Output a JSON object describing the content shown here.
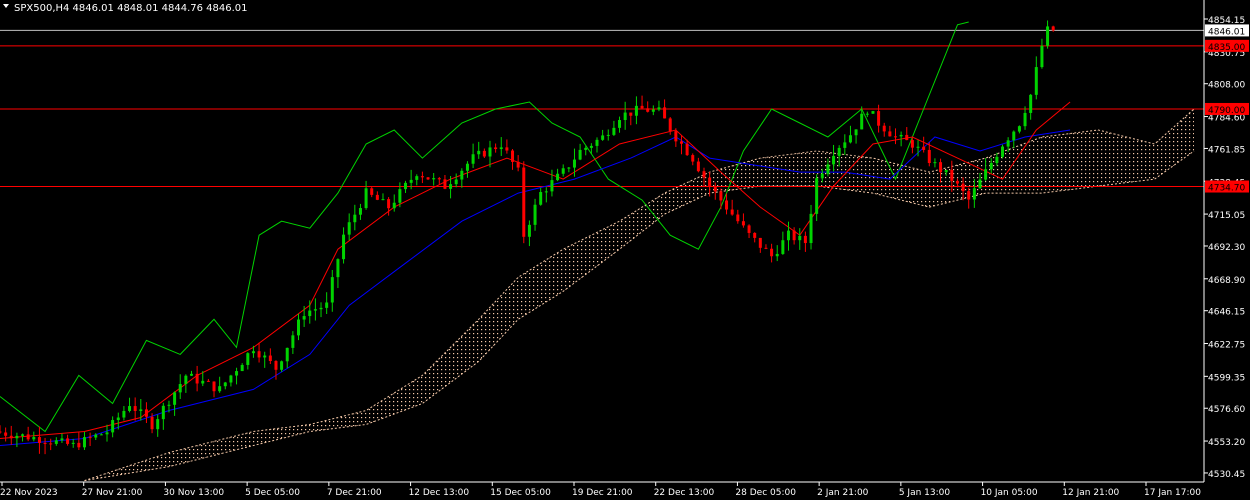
{
  "header": {
    "symbol_line": "SPX500,H4  4846.01 4848.01 4844.76 4846.01",
    "dropdown_icon": "triangle-down-icon"
  },
  "colors": {
    "background": "#000000",
    "grid_text": "#ffffff",
    "bull_candle": "#00d400",
    "bear_candle": "#ff0000",
    "tenkan": "#ff0000",
    "kijun": "#0000ff",
    "chikou": "#00d400",
    "kumo": "#f4c8a8",
    "level_line": "#ff0000",
    "price_badge": "#ff0000",
    "current_price_bg": "#ffffff"
  },
  "chart_data": {
    "type": "candlestick",
    "instrument": "SPX500",
    "timeframe": "H4",
    "ohlc_last": {
      "open": 4846.01,
      "high": 4848.01,
      "low": 4844.76,
      "close": 4846.01
    },
    "ylim": [
      4524,
      4862
    ],
    "y_ticks": [
      "4854.15",
      "4830.75",
      "4808.00",
      "4784.60",
      "4761.85",
      "4738.45",
      "4715.05",
      "4692.30",
      "4668.90",
      "4646.15",
      "4622.75",
      "4599.35",
      "4576.60",
      "4553.20",
      "4530.45"
    ],
    "x_ticks": [
      "22 Nov 2023",
      "27 Nov 21:00",
      "30 Nov 13:00",
      "5 Dec 05:00",
      "7 Dec 21:00",
      "12 Dec 13:00",
      "15 Dec 05:00",
      "19 Dec 21:00",
      "22 Dec 13:00",
      "28 Dec 05:00",
      "2 Jan 21:00",
      "5 Jan 13:00",
      "10 Jan 05:00",
      "12 Jan 21:00",
      "17 Jan 17:00"
    ],
    "current_price": "4846.01",
    "levels": [
      {
        "label": "4835.00",
        "value": 4835.0
      },
      {
        "label": "4790.00",
        "value": 4790.0
      },
      {
        "label": "4734.70",
        "value": 4734.7
      }
    ],
    "price_path": [
      [
        0,
        4560
      ],
      [
        8,
        4555
      ],
      [
        14,
        4550
      ],
      [
        20,
        4560
      ],
      [
        24,
        4580
      ],
      [
        28,
        4565
      ],
      [
        34,
        4600
      ],
      [
        40,
        4590
      ],
      [
        46,
        4620
      ],
      [
        50,
        4605
      ],
      [
        55,
        4645
      ],
      [
        59,
        4650
      ],
      [
        62,
        4700
      ],
      [
        66,
        4730
      ],
      [
        70,
        4720
      ],
      [
        75,
        4745
      ],
      [
        80,
        4735
      ],
      [
        85,
        4755
      ],
      [
        90,
        4765
      ],
      [
        93,
        4745
      ],
      [
        94,
        4700
      ],
      [
        97,
        4730
      ],
      [
        101,
        4745
      ],
      [
        104,
        4760
      ],
      [
        108,
        4770
      ],
      [
        111,
        4785
      ],
      [
        115,
        4790
      ],
      [
        118,
        4788
      ],
      [
        121,
        4770
      ],
      [
        124,
        4755
      ],
      [
        127,
        4735
      ],
      [
        130,
        4720
      ],
      [
        134,
        4700
      ],
      [
        138,
        4685
      ],
      [
        141,
        4700
      ],
      [
        144,
        4695
      ],
      [
        146,
        4740
      ],
      [
        149,
        4760
      ],
      [
        152,
        4772
      ],
      [
        155,
        4790
      ],
      [
        157,
        4780
      ],
      [
        160,
        4770
      ],
      [
        163,
        4765
      ],
      [
        167,
        4750
      ],
      [
        170,
        4740
      ],
      [
        173,
        4725
      ],
      [
        176,
        4745
      ],
      [
        179,
        4765
      ],
      [
        182,
        4780
      ],
      [
        184,
        4800
      ],
      [
        186,
        4835
      ],
      [
        187,
        4846
      ]
    ],
    "tenkan_path": [
      [
        0,
        4555
      ],
      [
        15,
        4560
      ],
      [
        25,
        4570
      ],
      [
        35,
        4600
      ],
      [
        45,
        4620
      ],
      [
        55,
        4650
      ],
      [
        60,
        4690
      ],
      [
        70,
        4720
      ],
      [
        80,
        4740
      ],
      [
        90,
        4755
      ],
      [
        100,
        4740
      ],
      [
        110,
        4765
      ],
      [
        120,
        4775
      ],
      [
        128,
        4745
      ],
      [
        135,
        4720
      ],
      [
        142,
        4700
      ],
      [
        148,
        4735
      ],
      [
        155,
        4765
      ],
      [
        162,
        4770
      ],
      [
        170,
        4755
      ],
      [
        178,
        4740
      ],
      [
        184,
        4775
      ],
      [
        190,
        4795
      ]
    ],
    "kijun_path": [
      [
        0,
        4550
      ],
      [
        15,
        4555
      ],
      [
        30,
        4575
      ],
      [
        45,
        4590
      ],
      [
        55,
        4615
      ],
      [
        62,
        4650
      ],
      [
        72,
        4680
      ],
      [
        82,
        4710
      ],
      [
        92,
        4730
      ],
      [
        102,
        4740
      ],
      [
        112,
        4755
      ],
      [
        120,
        4770
      ],
      [
        126,
        4755
      ],
      [
        134,
        4750
      ],
      [
        142,
        4745
      ],
      [
        150,
        4745
      ],
      [
        158,
        4740
      ],
      [
        166,
        4770
      ],
      [
        174,
        4760
      ],
      [
        182,
        4770
      ],
      [
        190,
        4775
      ]
    ],
    "chikou_path": [
      [
        0,
        4585
      ],
      [
        8,
        4560
      ],
      [
        14,
        4600
      ],
      [
        20,
        4580
      ],
      [
        26,
        4625
      ],
      [
        32,
        4615
      ],
      [
        38,
        4640
      ],
      [
        42,
        4620
      ],
      [
        46,
        4700
      ],
      [
        50,
        4710
      ],
      [
        55,
        4705
      ],
      [
        60,
        4730
      ],
      [
        65,
        4765
      ],
      [
        70,
        4775
      ],
      [
        75,
        4755
      ],
      [
        82,
        4780
      ],
      [
        88,
        4790
      ],
      [
        94,
        4795
      ],
      [
        98,
        4780
      ],
      [
        103,
        4770
      ],
      [
        108,
        4740
      ],
      [
        114,
        4725
      ],
      [
        119,
        4700
      ],
      [
        124,
        4690
      ],
      [
        128,
        4720
      ],
      [
        132,
        4760
      ],
      [
        137,
        4790
      ],
      [
        142,
        4780
      ],
      [
        147,
        4770
      ],
      [
        153,
        4790
      ],
      [
        159,
        4740
      ],
      [
        163,
        4780
      ],
      [
        166,
        4810
      ],
      [
        170,
        4850
      ],
      [
        172,
        4852
      ]
    ],
    "kumo_upper": [
      [
        15,
        4525
      ],
      [
        30,
        4545
      ],
      [
        45,
        4560
      ],
      [
        55,
        4565
      ],
      [
        65,
        4575
      ],
      [
        75,
        4600
      ],
      [
        85,
        4640
      ],
      [
        92,
        4670
      ],
      [
        100,
        4690
      ],
      [
        110,
        4710
      ],
      [
        118,
        4730
      ],
      [
        126,
        4745
      ],
      [
        135,
        4755
      ],
      [
        145,
        4760
      ],
      [
        155,
        4755
      ],
      [
        165,
        4745
      ],
      [
        175,
        4755
      ],
      [
        185,
        4770
      ],
      [
        195,
        4775
      ],
      [
        205,
        4765
      ],
      [
        212,
        4790
      ]
    ],
    "kumo_lower": [
      [
        15,
        4525
      ],
      [
        30,
        4535
      ],
      [
        45,
        4550
      ],
      [
        55,
        4560
      ],
      [
        65,
        4565
      ],
      [
        75,
        4580
      ],
      [
        85,
        4610
      ],
      [
        92,
        4640
      ],
      [
        100,
        4660
      ],
      [
        110,
        4690
      ],
      [
        118,
        4715
      ],
      [
        126,
        4730
      ],
      [
        135,
        4735
      ],
      [
        145,
        4735
      ],
      [
        155,
        4730
      ],
      [
        165,
        4720
      ],
      [
        175,
        4730
      ],
      [
        185,
        4730
      ],
      [
        195,
        4735
      ],
      [
        205,
        4740
      ],
      [
        212,
        4760
      ]
    ],
    "x_domain": [
      0,
      212
    ]
  }
}
